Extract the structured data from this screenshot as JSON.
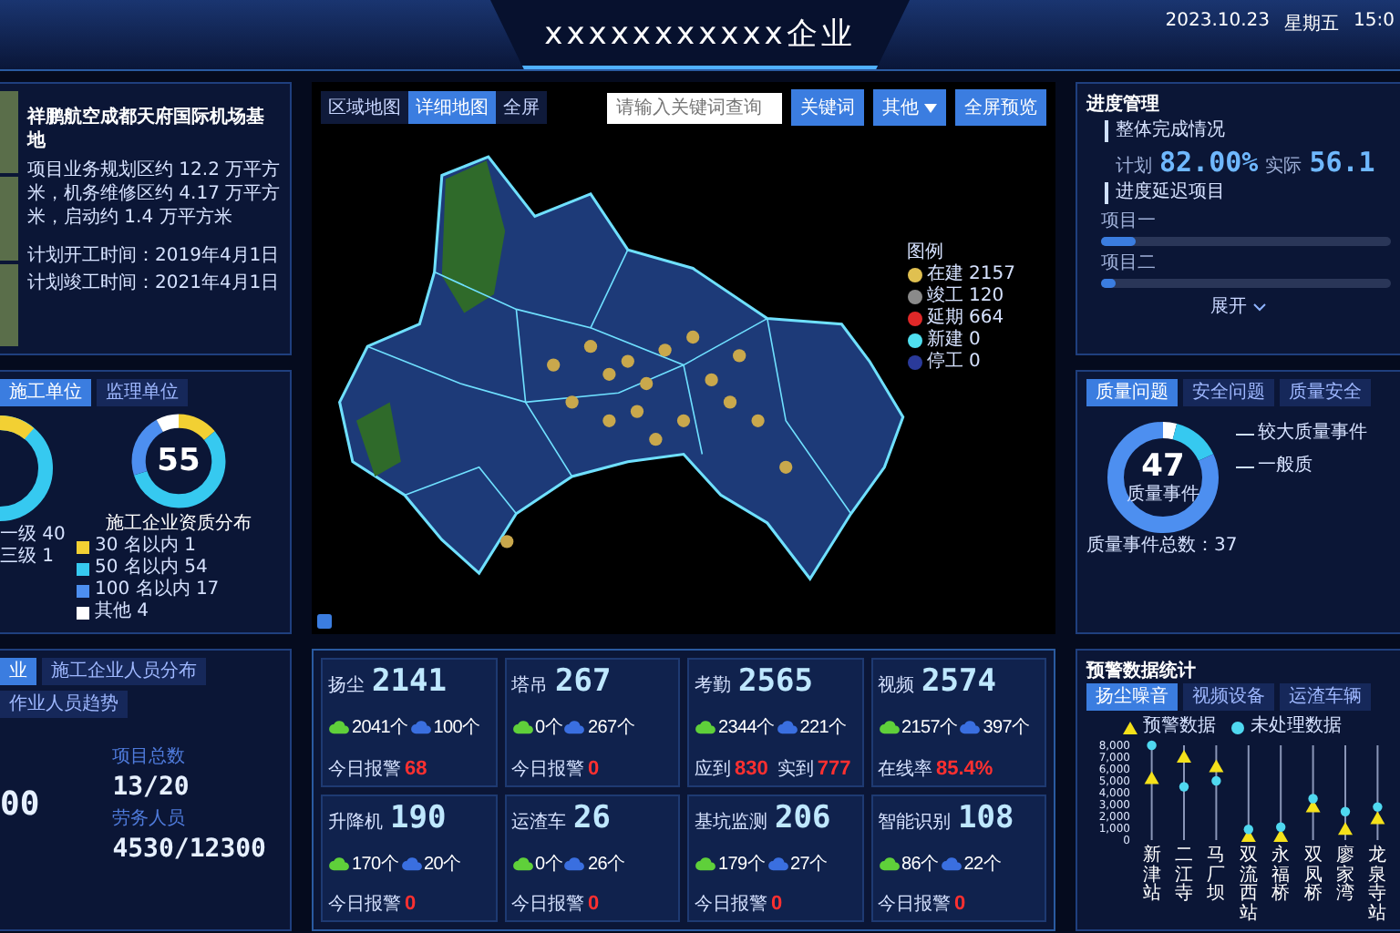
{
  "header": {
    "title": "xxxxxxxxxxx企业",
    "date": "2023.10.23",
    "weekday": "星期五",
    "time": "15:0"
  },
  "project": {
    "title": "祥鹏航空成都天府国际机场基地",
    "description": "项目业务规划区约 12.2 万平方米，机务维修区约 4.17 万平方米，启动约 1.4 万平方米",
    "dates": [
      "计划开工时间：2019年4月1日",
      "计划竣工时间：2021年4月1日"
    ]
  },
  "units": {
    "tabs": [
      {
        "label": "施工单位",
        "selected": true
      },
      {
        "label": "监理单位",
        "selected": false
      }
    ],
    "left_legend": [
      "一级 40",
      "三级 1"
    ],
    "donut": {
      "value": "55",
      "label": "施工企业资质分布"
    },
    "legend": [
      {
        "label": "30 名以内 1",
        "color": "#f2d033"
      },
      {
        "label": "50 名以内 54",
        "color": "#36c9f0"
      },
      {
        "label": "100 名以内 17",
        "color": "#4d8ff0"
      },
      {
        "label": "其他 4",
        "color": "#ffffff"
      }
    ]
  },
  "staff": {
    "tabs": [
      {
        "label": "业",
        "selected": true
      },
      {
        "label": "施工企业人员分布",
        "selected": false
      },
      {
        "label": "作业人员趋势",
        "selected": false
      }
    ],
    "cut_value": "00",
    "stats": [
      {
        "label": "项目总数",
        "value": "13/20"
      },
      {
        "label": "劳务人员",
        "value": "4530/12300"
      }
    ]
  },
  "map": {
    "view_tabs": [
      {
        "label": "区域地图",
        "selected": false
      },
      {
        "label": "详细地图",
        "selected": true
      },
      {
        "label": "全屏",
        "selected": false
      }
    ],
    "search": {
      "placeholder": "请输入关键词查询"
    },
    "search_button": "关键词",
    "dropdown": "其他",
    "preview_button": "全屏预览",
    "legend_title": "图例",
    "legend": [
      {
        "label": "在建",
        "count": "2157",
        "color": "#e0c050"
      },
      {
        "label": "竣工",
        "count": "120",
        "color": "#8a8a8a"
      },
      {
        "label": "延期",
        "count": "664",
        "color": "#e02828"
      },
      {
        "label": "新建",
        "count": "0",
        "color": "#4fe0f0"
      },
      {
        "label": "停工",
        "count": "0",
        "color": "#2a3a9a"
      }
    ]
  },
  "devices": [
    {
      "name": "扬尘",
      "total": "2141",
      "online": "2041个",
      "offline": "100个",
      "footer": [
        {
          "label": "今日报警",
          "value": "68"
        }
      ]
    },
    {
      "name": "塔吊",
      "total": "267",
      "online": "0个",
      "offline": "267个",
      "footer": [
        {
          "label": "今日报警",
          "value": "0"
        }
      ]
    },
    {
      "name": "考勤",
      "total": "2565",
      "online": "2344个",
      "offline": "221个",
      "footer": [
        {
          "label": "应到",
          "value": "830"
        },
        {
          "label": "实到",
          "value": "777"
        }
      ]
    },
    {
      "name": "视频",
      "total": "2574",
      "online": "2157个",
      "offline": "397个",
      "footer": [
        {
          "label": "在线率",
          "value": "85.4%"
        }
      ]
    },
    {
      "name": "升降机",
      "total": "190",
      "online": "170个",
      "offline": "20个",
      "footer": [
        {
          "label": "今日报警",
          "value": "0"
        }
      ]
    },
    {
      "name": "运渣车",
      "total": "26",
      "online": "0个",
      "offline": "26个",
      "footer": [
        {
          "label": "今日报警",
          "value": "0"
        }
      ]
    },
    {
      "name": "基坑监测",
      "total": "206",
      "online": "179个",
      "offline": "27个",
      "footer": [
        {
          "label": "今日报警",
          "value": "0"
        }
      ]
    },
    {
      "name": "智能识别",
      "total": "108",
      "online": "86个",
      "offline": "22个",
      "footer": [
        {
          "label": "今日报警",
          "value": "0"
        }
      ]
    }
  ],
  "progress": {
    "title": "进度管理",
    "overall_label": "整体完成情况",
    "plan_label": "计划",
    "plan": "82.00%",
    "actual_label": "实际",
    "actual": "56.1",
    "delay_label": "进度延迟项目",
    "bars": [
      {
        "label": "项目一",
        "level": 0.12
      },
      {
        "label": "项目二",
        "level": 0.05
      }
    ],
    "expand": "展开"
  },
  "quality": {
    "tabs": [
      {
        "label": "质量问题",
        "selected": true
      },
      {
        "label": "安全问题",
        "selected": false
      },
      {
        "label": "质量安全",
        "selected": false
      }
    ],
    "donut": {
      "value": "47",
      "label": "质量事件"
    },
    "callouts": [
      "较大质量事件",
      "一般质"
    ],
    "total": "质量事件总数：37"
  },
  "warnings": {
    "title": "预警数据统计",
    "tabs": [
      {
        "label": "扬尘噪音",
        "selected": true
      },
      {
        "label": "视频设备",
        "selected": false
      },
      {
        "label": "运渣车辆",
        "selected": false
      }
    ],
    "chart_data": {
      "type": "scatter",
      "grid": true,
      "categories": [
        "新津站",
        "二江寺",
        "马厂坝",
        "双流西站",
        "永福桥",
        "双凤桥",
        "廖家湾",
        "龙泉寺站"
      ],
      "series": [
        {
          "name": "预警数据",
          "color": "#f5e11a",
          "values": [
            5200,
            7000,
            6200,
            300,
            300,
            2800,
            900,
            1800
          ]
        },
        {
          "name": "未处理数据",
          "color": "#4fd8f0",
          "values": [
            8000,
            4500,
            5000,
            900,
            1100,
            3500,
            2400,
            2800
          ]
        }
      ],
      "ylim": [
        0,
        8000
      ],
      "yticks": [
        0,
        {
          "value": 1000,
          "label": "1,000"
        },
        {
          "value": 2000,
          "label": "2,000"
        },
        {
          "value": 3000,
          "label": "3,000"
        },
        {
          "value": 4000,
          "label": "4,000"
        },
        {
          "value": 5000,
          "label": "5,000"
        },
        {
          "value": 6000,
          "label": "6,000"
        },
        {
          "value": 7000,
          "label": "7,000"
        },
        {
          "value": 8000,
          "label": "8,000"
        }
      ]
    }
  }
}
